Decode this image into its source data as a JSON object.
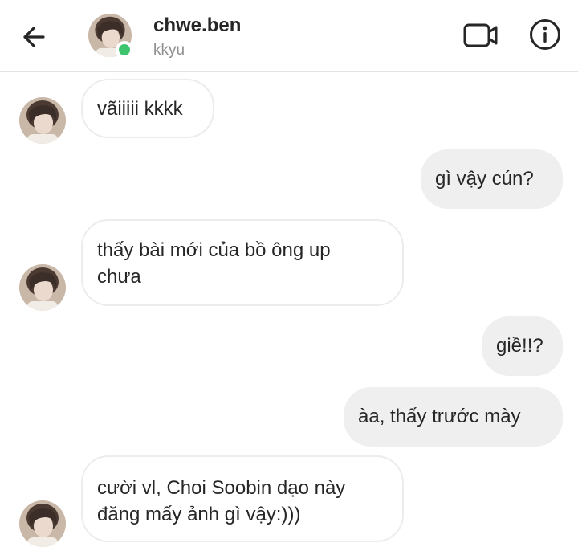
{
  "header": {
    "name": "chwe.ben",
    "subtitle": "kkyu",
    "online_color": "#3ec46d"
  },
  "icons": {
    "back": "arrow-left-icon",
    "video": "video-camera-icon",
    "info": "info-circle-icon"
  },
  "messages": [
    {
      "direction": "incoming",
      "text": "vãiiiii kkkk"
    },
    {
      "direction": "outgoing",
      "text": "gì vậy cún?"
    },
    {
      "direction": "incoming",
      "text": "thấy bài mới của bồ ông up\nchưa"
    },
    {
      "direction": "outgoing",
      "text": "giề!!?"
    },
    {
      "direction": "outgoing",
      "text": "àa, thấy trước mày"
    },
    {
      "direction": "incoming",
      "text": "cười vl, Choi Soobin dạo này\nđăng mấy ảnh gì vậy:)))"
    }
  ],
  "colors": {
    "incoming_bubble_border": "#ececec",
    "outgoing_bubble_bg": "#efefef",
    "text": "#262626",
    "subtext": "#8e8e8e"
  }
}
